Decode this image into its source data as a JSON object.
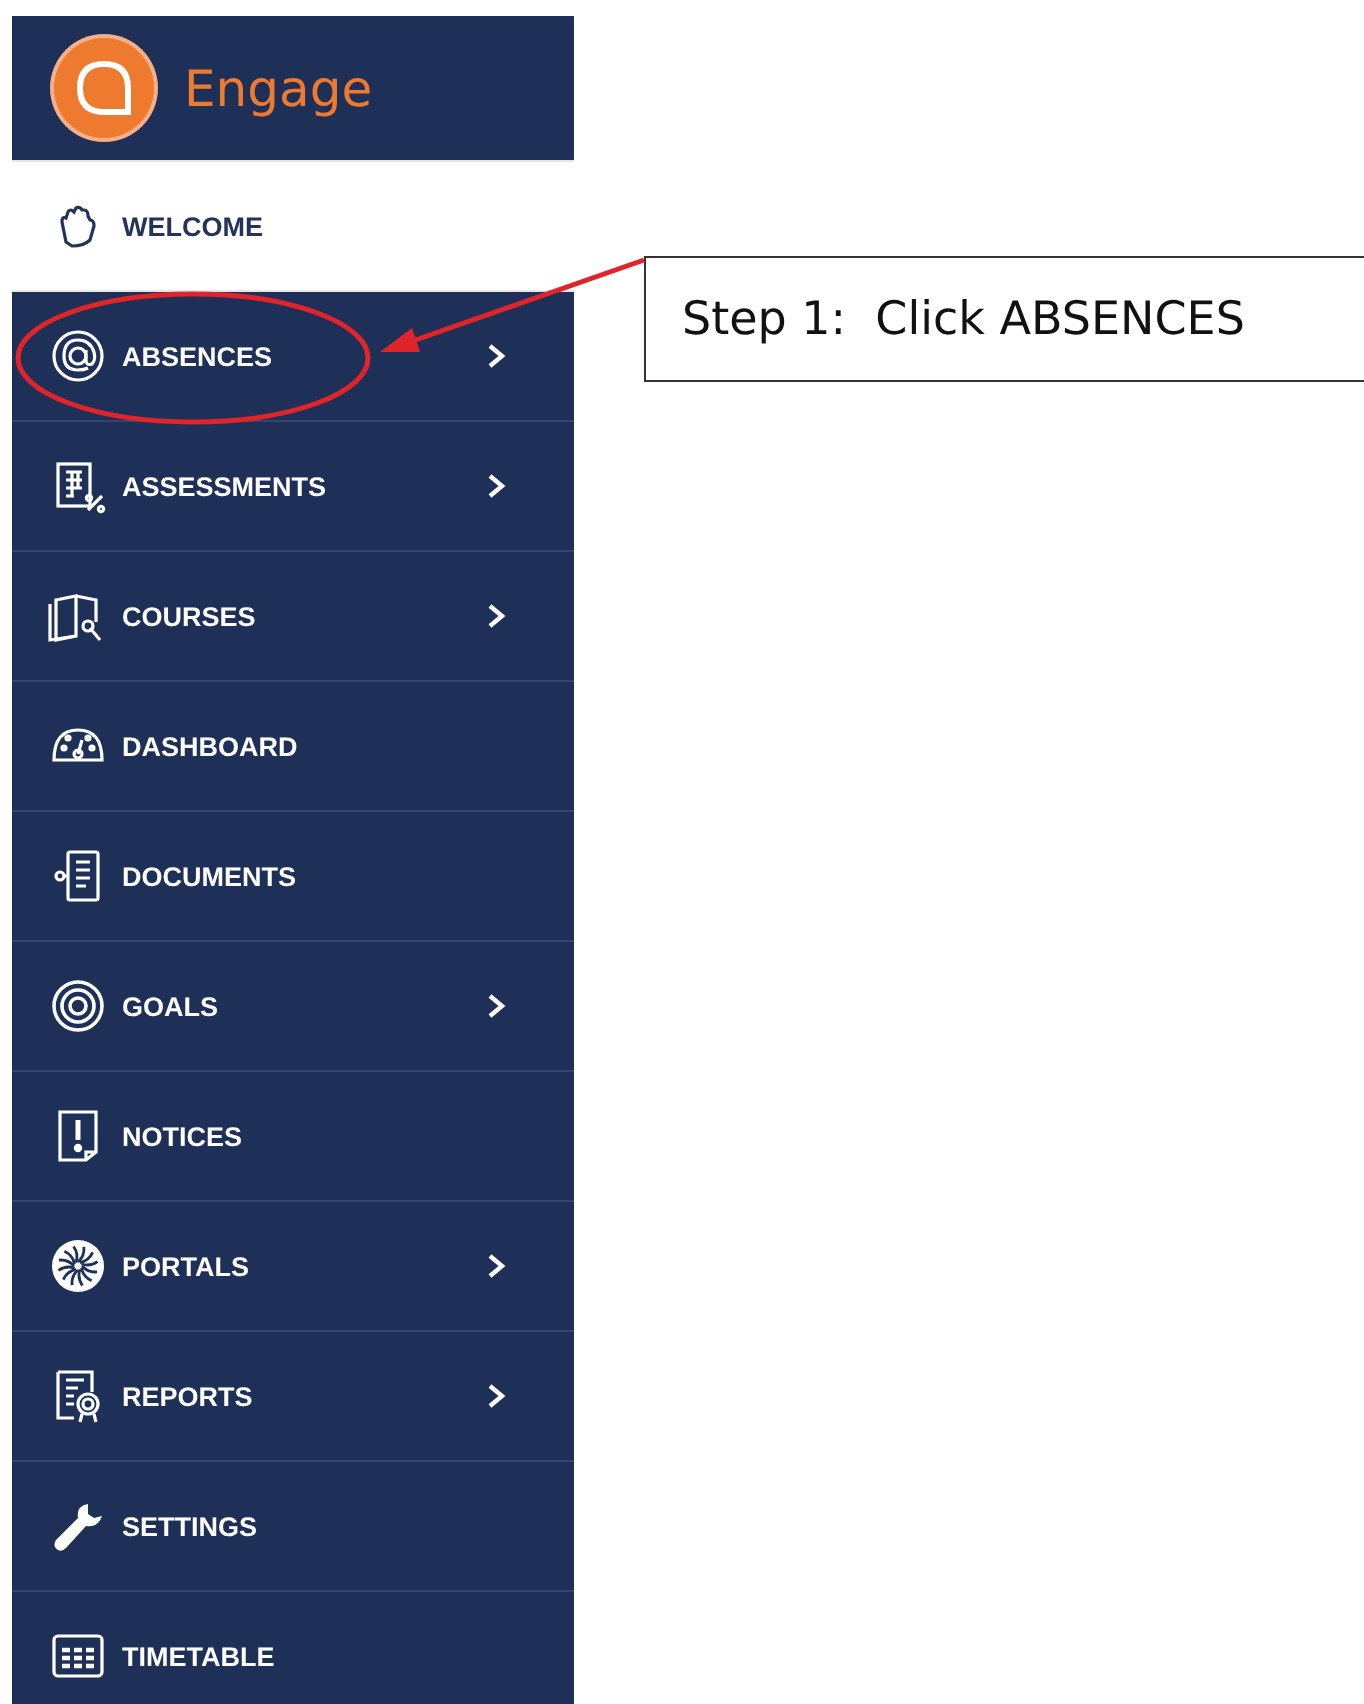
{
  "logo": {
    "text": "Engage"
  },
  "sidebar": {
    "items": [
      {
        "label": "WELCOME",
        "selected": true,
        "submenu": false
      },
      {
        "label": "ABSENCES",
        "selected": false,
        "submenu": true
      },
      {
        "label": "ASSESSMENTS",
        "selected": false,
        "submenu": true
      },
      {
        "label": "COURSES",
        "selected": false,
        "submenu": true
      },
      {
        "label": "DASHBOARD",
        "selected": false,
        "submenu": false
      },
      {
        "label": "DOCUMENTS",
        "selected": false,
        "submenu": false
      },
      {
        "label": "GOALS",
        "selected": false,
        "submenu": true
      },
      {
        "label": "NOTICES",
        "selected": false,
        "submenu": false
      },
      {
        "label": "PORTALS",
        "selected": false,
        "submenu": true
      },
      {
        "label": "REPORTS",
        "selected": false,
        "submenu": true
      },
      {
        "label": "SETTINGS",
        "selected": false,
        "submenu": false
      },
      {
        "label": "TIMETABLE",
        "selected": false,
        "submenu": false
      }
    ]
  },
  "callout": {
    "text": "Step 1:  Click ABSENCES"
  }
}
